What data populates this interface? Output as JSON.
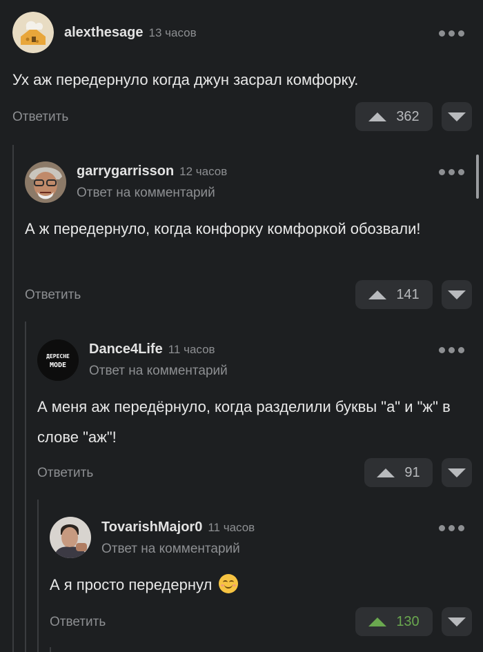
{
  "comments": [
    {
      "author": "alexthesage",
      "time": "13 часов",
      "reply_to": "",
      "text": "Ух аж передернуло когда джун засрал комфорку.",
      "reply_label": "Ответить",
      "votes": "362",
      "avatar": "cheese-house-avatar"
    },
    {
      "author": "garrygarrisson",
      "time": "12 часов",
      "reply_to": "Ответ на комментарий",
      "text": "А ж передернуло, когда конфорку комфоркой обозвали!",
      "reply_label": "Ответить",
      "votes": "141",
      "avatar": "old-man-avatar"
    },
    {
      "author": "Dance4Life",
      "time": "11 часов",
      "reply_to": "Ответ на комментарий",
      "text": "А меня аж передёрнуло, когда разделили буквы \"а\" и \"ж\" в слове \"аж\"!",
      "reply_label": "Ответить",
      "votes": "91",
      "avatar": "depeche-mode-avatar",
      "avatar_text_1": "ДЕРЕСНЕ",
      "avatar_text_2": "MODE"
    },
    {
      "author": "TovarishMajor0",
      "time": "11 часов",
      "reply_to": "Ответ на комментарий",
      "text": "А я просто передернул",
      "reply_label": "Ответить",
      "votes": "130",
      "avatar": "man-photo-avatar",
      "emoji": "smiling-face"
    }
  ],
  "colors": {
    "background": "#1d1f21",
    "positive_vote": "#6aa84f",
    "muted": "#8d8f92"
  }
}
